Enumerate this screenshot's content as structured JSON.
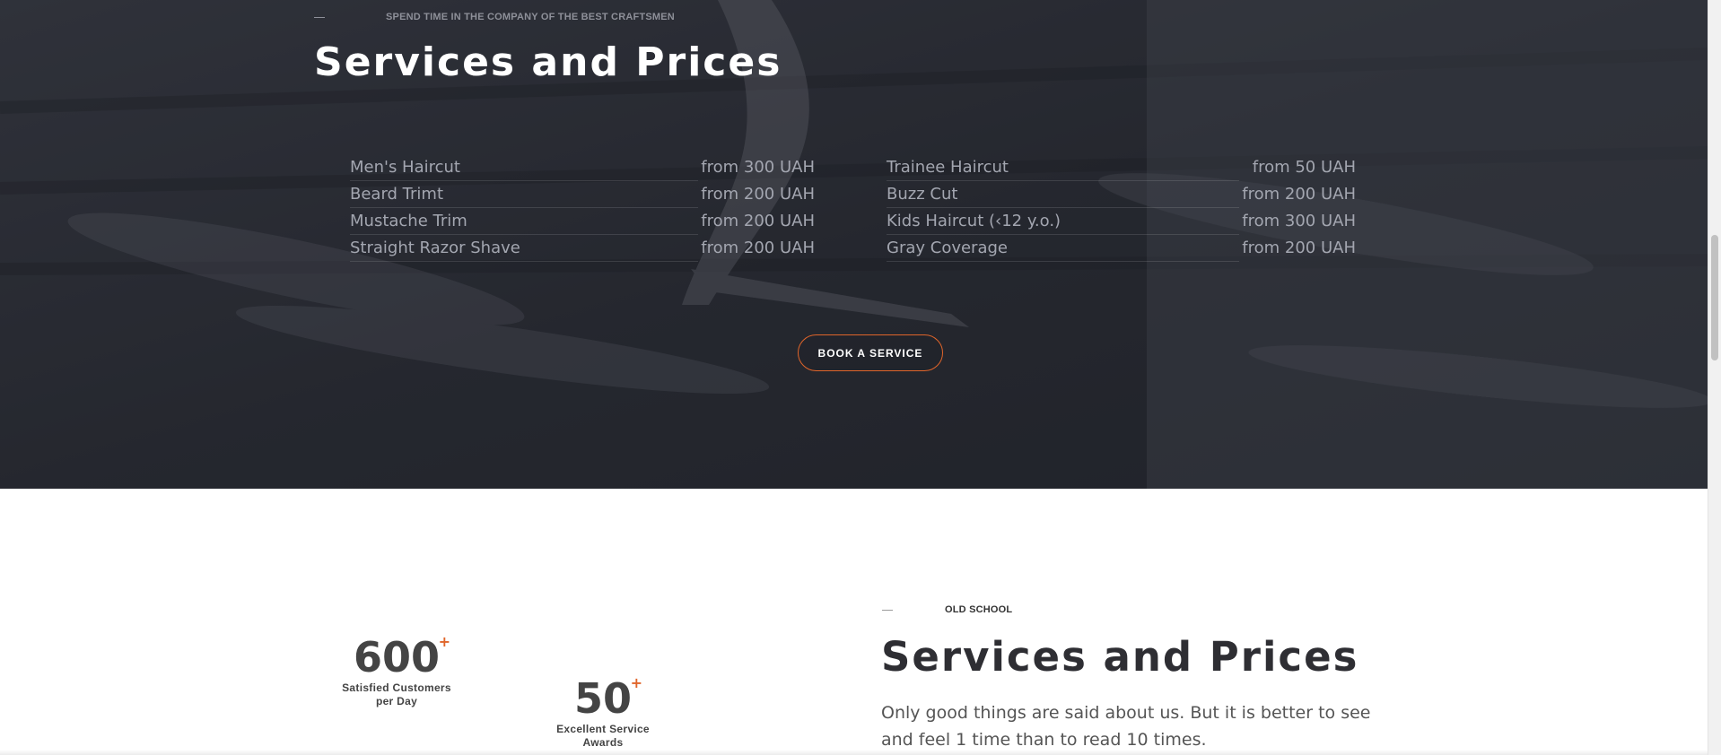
{
  "hero": {
    "eyebrow": "SPEND TIME IN THE COMPANY OF THE BEST CRAFTSMEN",
    "title": "Services and Prices",
    "price_list_left": [
      {
        "name": "Men's Haircut",
        "price": "from 300 UAH"
      },
      {
        "name": "Beard Trimt",
        "price": "from 200 UAH"
      },
      {
        "name": "Mustache Trim",
        "price": "from 200 UAH"
      },
      {
        "name": "Straight Razor Shave",
        "price": "from 200 UAH"
      }
    ],
    "price_list_right": [
      {
        "name": "Trainee Haircut",
        "price": "from 50 UAH"
      },
      {
        "name": "Buzz Cut",
        "price": "from 200 UAH"
      },
      {
        "name": "Kids Haircut (‹12 y.o.)",
        "price": "from 300 UAH"
      },
      {
        "name": "Gray Coverage",
        "price": "from 200 UAH"
      }
    ],
    "book_button_label": "BOOK A SERVICE"
  },
  "stats": [
    {
      "value": "600",
      "suffix": "+",
      "label_line1": "Satisfied Customers",
      "label_line2": "per Day"
    },
    {
      "value": "50",
      "suffix": "+",
      "label_line1": "Excellent Service",
      "label_line2": "Awards"
    }
  ],
  "about": {
    "eyebrow": "OLD SCHOOL",
    "title": "Services and Prices",
    "text": "Only good things are said about us. But it is better   to see and feel 1 time than to read 10 times."
  },
  "colors": {
    "accent": "#e0652a",
    "hero_overlay": "#2b2d35",
    "heading_dark": "#2e2e33",
    "body_text": "#555555"
  }
}
